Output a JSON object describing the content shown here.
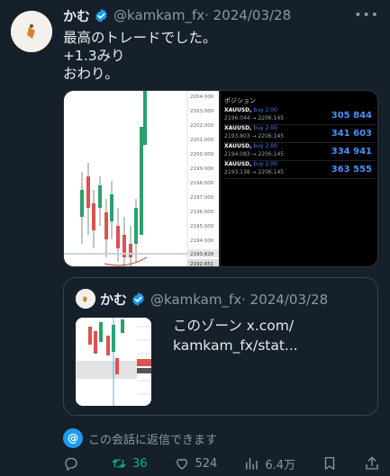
{
  "tweet": {
    "display_name": "かむ",
    "handle": "@kamkam_fx",
    "date": "· 2024/03/28",
    "more": "•••",
    "lines": [
      "最高のトレードでした。",
      "+1.3みり",
      "おわり。"
    ]
  },
  "media": {
    "chart_prices": [
      "2204.000",
      "2203.000",
      "2202.000",
      "2201.000",
      "2200.000",
      "2199.000",
      "2198.000",
      "2197.000",
      "2196.000",
      "2195.000",
      "2194.000",
      "2193.626",
      "2192.651"
    ],
    "positions_title": "ポジション",
    "positions": [
      {
        "symbol": "XAUUSD,",
        "side": "buy 2.00",
        "prices": "2196.044 → 2206.145",
        "pl": "305 844"
      },
      {
        "symbol": "XAUUSD,",
        "side": "buy 2.00",
        "prices": "2193.803 → 2206.145",
        "pl": "341 603"
      },
      {
        "symbol": "XAUUSD,",
        "side": "buy 2.00",
        "prices": "2194.083 → 2206.145",
        "pl": "334 941"
      },
      {
        "symbol": "XAUUSD,",
        "side": "buy 2.00",
        "prices": "2193.138 → 2206.145",
        "pl": "363 555"
      }
    ]
  },
  "quote": {
    "display_name": "かむ",
    "handle": "@kamkam_fx",
    "date": "· 2024/03/28",
    "text_line1": "このゾーン x.com/",
    "text_line2": "kamkam_fx/stat..."
  },
  "reply_note": "この会話に返信できます",
  "actions": {
    "replies": "",
    "retweets": "36",
    "likes": "524",
    "views": "6.4万"
  },
  "colors": {
    "background": "#15202b",
    "accent": "#1d9bf0",
    "retweet": "#00ba7c",
    "muted": "#8b98a5"
  }
}
